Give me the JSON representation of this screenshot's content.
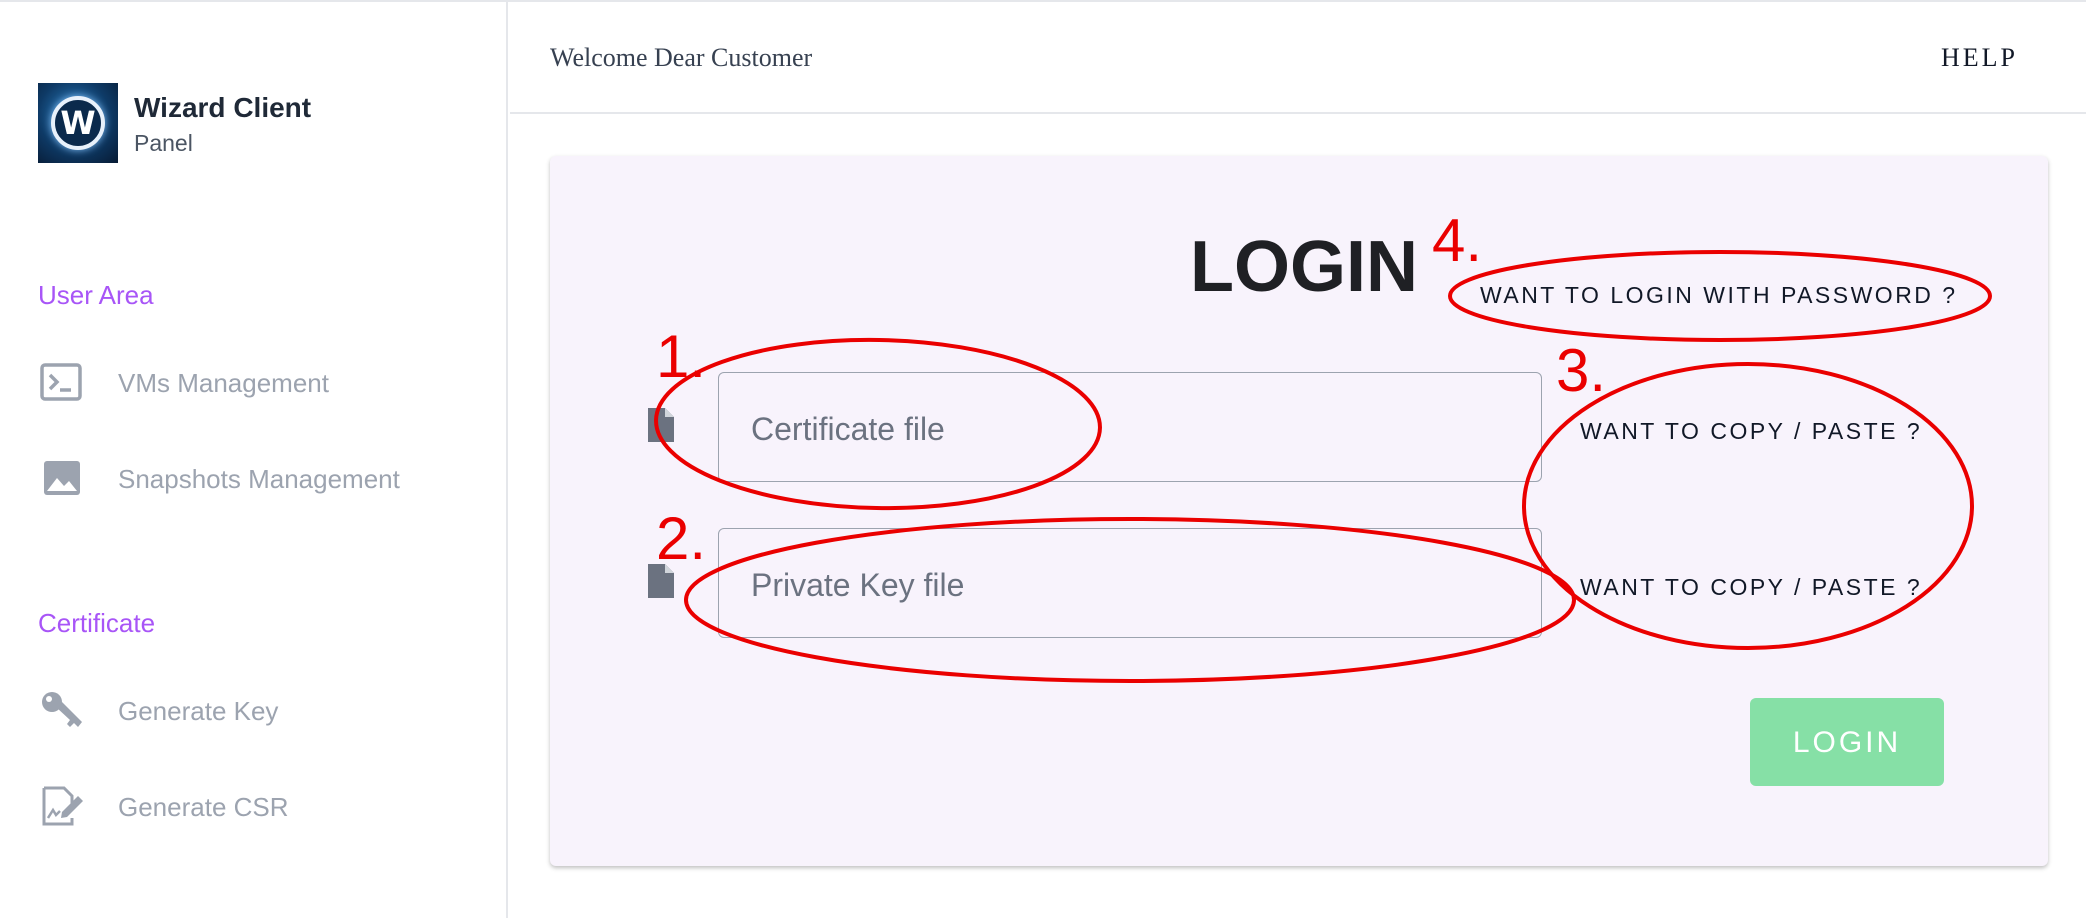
{
  "sidebar": {
    "brand": {
      "title": "Wizard Client",
      "subtitle": "Panel",
      "logo_letter": "W",
      "logo_icon": "wizard-logo"
    },
    "sections": [
      {
        "title": "User Area",
        "items": [
          {
            "label": "VMs Management",
            "icon": "terminal-icon"
          },
          {
            "label": "Snapshots Management",
            "icon": "image-icon"
          }
        ]
      },
      {
        "title": "Certificate",
        "items": [
          {
            "label": "Generate Key",
            "icon": "key-icon"
          },
          {
            "label": "Generate CSR",
            "icon": "signature-icon"
          }
        ]
      }
    ],
    "section_color": "#a855f7"
  },
  "header": {
    "welcome": "Welcome Dear Customer",
    "help": "HELP"
  },
  "login": {
    "title": "LOGIN",
    "password_link": "WANT TO LOGIN WITH PASSWORD ?",
    "certificate_placeholder": "Certificate file",
    "private_key_placeholder": "Private Key file",
    "copy_paste_certificate": "WANT TO COPY / PASTE ?",
    "copy_paste_key": "WANT TO COPY / PASTE ?",
    "button": "LOGIN",
    "button_color": "#86e0a6"
  },
  "annotations": {
    "color": "#ea0000",
    "labels": [
      "1.",
      "2.",
      "3.",
      "4."
    ]
  }
}
